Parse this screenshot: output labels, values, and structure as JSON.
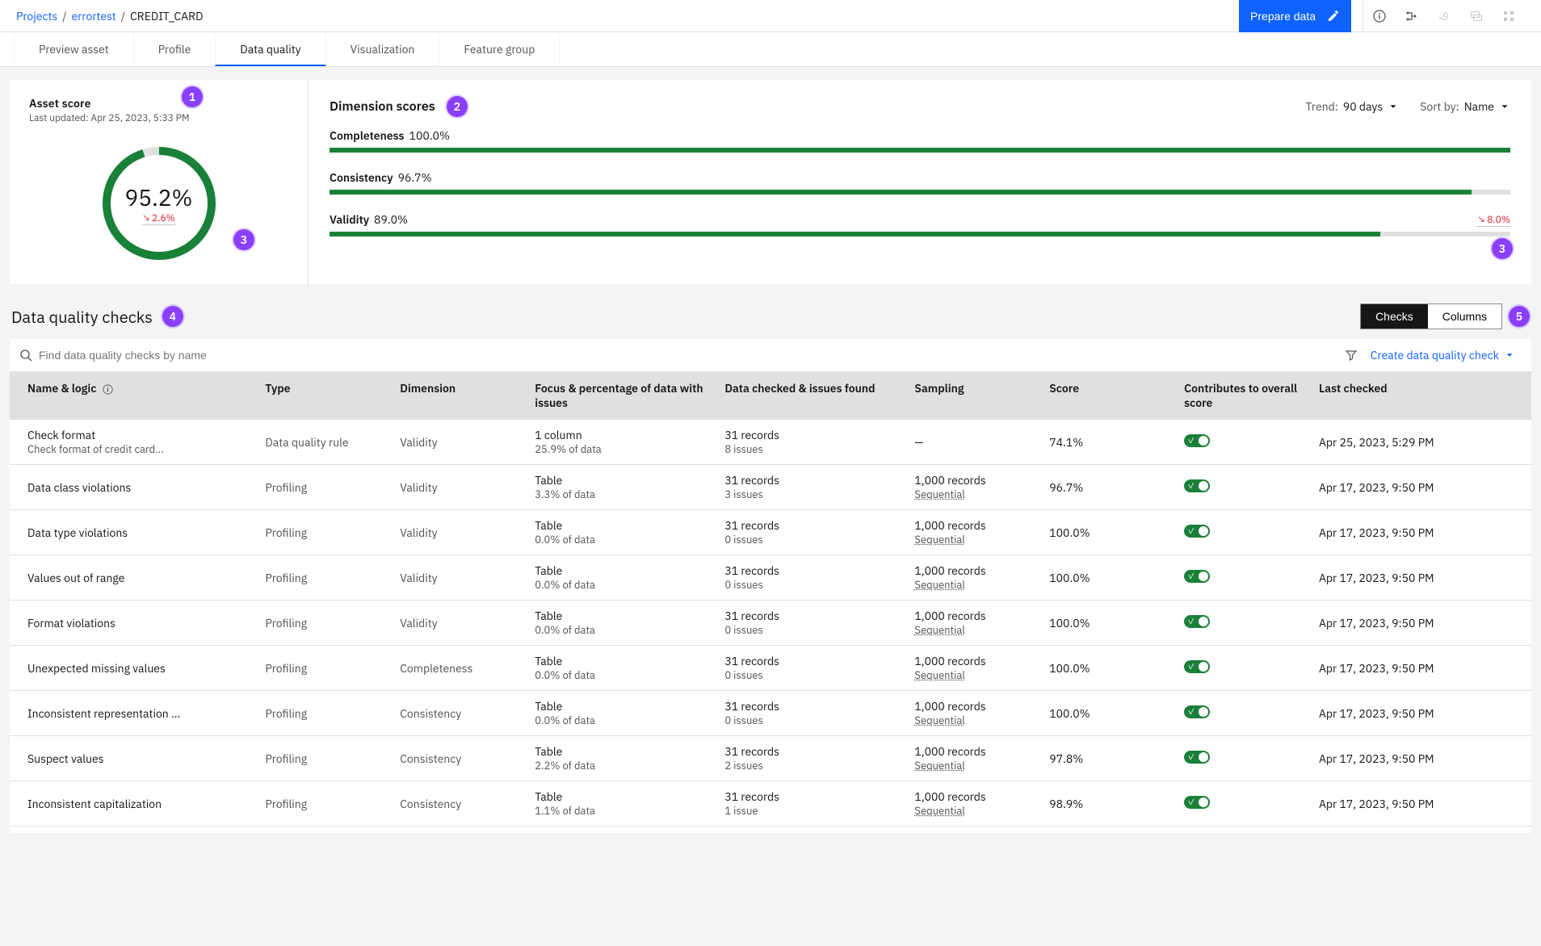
{
  "breadcrumb": {
    "projects": "Projects",
    "project": "errortest",
    "asset": "CREDIT_CARD"
  },
  "topbar": {
    "prepare": "Prepare data"
  },
  "tabs": [
    "Preview asset",
    "Profile",
    "Data quality",
    "Visualization",
    "Feature group"
  ],
  "active_tab": 2,
  "asset_score": {
    "title": "Asset score",
    "subtitle": "Last updated: Apr 25, 2023, 5:33 PM",
    "value": "95.2%",
    "delta": "2.6%",
    "pct": 95.2
  },
  "dimension": {
    "title": "Dimension scores",
    "trend_label": "Trend:",
    "trend_value": "90 days",
    "sort_label": "Sort by:",
    "sort_value": "Name",
    "rows": [
      {
        "name": "Completeness",
        "pct": "100.0%",
        "fill": 100,
        "delta": ""
      },
      {
        "name": "Consistency",
        "pct": "96.7%",
        "fill": 96.7,
        "delta": ""
      },
      {
        "name": "Validity",
        "pct": "89.0%",
        "fill": 89.0,
        "delta": "8.0%"
      }
    ]
  },
  "checks": {
    "title": "Data quality checks",
    "seg_checks": "Checks",
    "seg_columns": "Columns",
    "search_placeholder": "Find data quality checks by name",
    "create": "Create data quality check",
    "columns": {
      "name": "Name & logic",
      "type": "Type",
      "dimension": "Dimension",
      "focus": "Focus & percentage of data with issues",
      "data": "Data checked & issues found",
      "sampling": "Sampling",
      "score": "Score",
      "contrib": "Contributes to overall score",
      "last": "Last checked"
    },
    "rows": [
      {
        "name": "Check format",
        "sub": "Check format of credit card n…",
        "type": "Data quality rule",
        "dimension": "Validity",
        "focus1": "1 column",
        "focus2": "25.9% of data",
        "data1": "31 records",
        "data2": "8 issues",
        "samp1": "—",
        "samp2": "",
        "score": "74.1%",
        "last": "Apr 25, 2023, 5:29 PM"
      },
      {
        "name": "Data class violations",
        "sub": "",
        "type": "Profiling",
        "dimension": "Validity",
        "focus1": "Table",
        "focus2": "3.3% of data",
        "data1": "31 records",
        "data2": "3 issues",
        "samp1": "1,000 records",
        "samp2": "Sequential",
        "score": "96.7%",
        "last": "Apr 17, 2023, 9:50 PM"
      },
      {
        "name": "Data type violations",
        "sub": "",
        "type": "Profiling",
        "dimension": "Validity",
        "focus1": "Table",
        "focus2": "0.0% of data",
        "data1": "31 records",
        "data2": "0 issues",
        "samp1": "1,000 records",
        "samp2": "Sequential",
        "score": "100.0%",
        "last": "Apr 17, 2023, 9:50 PM"
      },
      {
        "name": "Values out of range",
        "sub": "",
        "type": "Profiling",
        "dimension": "Validity",
        "focus1": "Table",
        "focus2": "0.0% of data",
        "data1": "31 records",
        "data2": "0 issues",
        "samp1": "1,000 records",
        "samp2": "Sequential",
        "score": "100.0%",
        "last": "Apr 17, 2023, 9:50 PM"
      },
      {
        "name": "Format violations",
        "sub": "",
        "type": "Profiling",
        "dimension": "Validity",
        "focus1": "Table",
        "focus2": "0.0% of data",
        "data1": "31 records",
        "data2": "0 issues",
        "samp1": "1,000 records",
        "samp2": "Sequential",
        "score": "100.0%",
        "last": "Apr 17, 2023, 9:50 PM"
      },
      {
        "name": "Unexpected missing values",
        "sub": "",
        "type": "Profiling",
        "dimension": "Completeness",
        "focus1": "Table",
        "focus2": "0.0% of data",
        "data1": "31 records",
        "data2": "0 issues",
        "samp1": "1,000 records",
        "samp2": "Sequential",
        "score": "100.0%",
        "last": "Apr 17, 2023, 9:50 PM"
      },
      {
        "name": "Inconsistent representation …",
        "sub": "",
        "type": "Profiling",
        "dimension": "Consistency",
        "focus1": "Table",
        "focus2": "0.0% of data",
        "data1": "31 records",
        "data2": "0 issues",
        "samp1": "1,000 records",
        "samp2": "Sequential",
        "score": "100.0%",
        "last": "Apr 17, 2023, 9:50 PM"
      },
      {
        "name": "Suspect values",
        "sub": "",
        "type": "Profiling",
        "dimension": "Consistency",
        "focus1": "Table",
        "focus2": "2.2% of data",
        "data1": "31 records",
        "data2": "2 issues",
        "samp1": "1,000 records",
        "samp2": "Sequential",
        "score": "97.8%",
        "last": "Apr 17, 2023, 9:50 PM"
      },
      {
        "name": "Inconsistent capitalization",
        "sub": "",
        "type": "Profiling",
        "dimension": "Consistency",
        "focus1": "Table",
        "focus2": "1.1% of data",
        "data1": "31 records",
        "data2": "1 issue",
        "samp1": "1,000 records",
        "samp2": "Sequential",
        "score": "98.9%",
        "last": "Apr 17, 2023, 9:50 PM"
      }
    ]
  },
  "chart_data": {
    "type": "bar",
    "title": "Dimension scores",
    "series": [
      {
        "name": "Score",
        "values": [
          100.0,
          96.7,
          89.0
        ]
      }
    ],
    "categories": [
      "Completeness",
      "Consistency",
      "Validity"
    ],
    "ylim": [
      0,
      100
    ],
    "asset_score": 95.2
  }
}
